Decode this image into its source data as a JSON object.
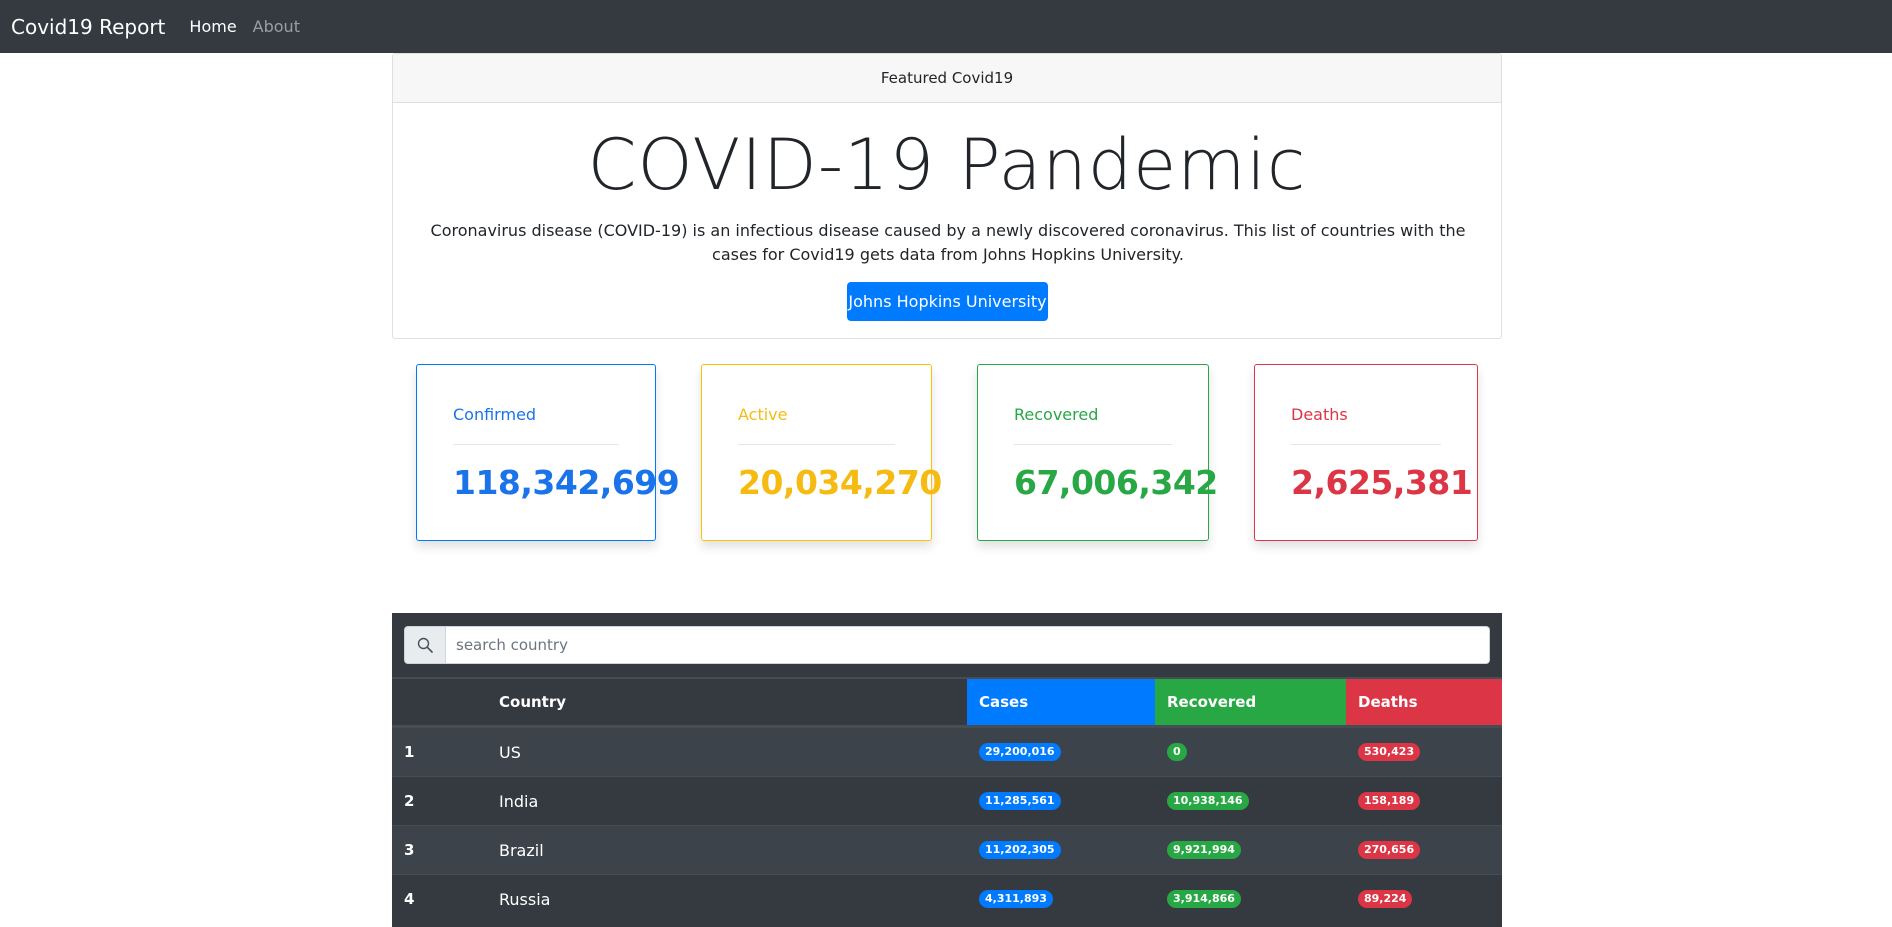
{
  "navbar": {
    "brand": "Covid19 Report",
    "links": [
      "Home",
      "About"
    ]
  },
  "featured": {
    "header": "Featured Covid19",
    "title": "COVID-19 Pandemic",
    "description": "Coronavirus disease (COVID-19) is an infectious disease caused by a newly discovered coronavirus. This list of countries with the cases for Covid19 gets data from Johns Hopkins University.",
    "button_label": "Johns Hopkins University"
  },
  "stats": {
    "confirmed": {
      "label": "Confirmed",
      "value": "118,342,699"
    },
    "active": {
      "label": "Active",
      "value": "20,034,270"
    },
    "recovered": {
      "label": "Recovered",
      "value": "67,006,342"
    },
    "deaths": {
      "label": "Deaths",
      "value": "2,625,381"
    }
  },
  "search": {
    "placeholder": "search country",
    "icon": "search-icon"
  },
  "table": {
    "headers": {
      "rank": "",
      "country": "Country",
      "cases": "Cases",
      "recovered": "Recovered",
      "deaths": "Deaths"
    },
    "rows": [
      {
        "rank": "1",
        "country": "US",
        "cases": "29,200,016",
        "recovered": "0",
        "deaths": "530,423"
      },
      {
        "rank": "2",
        "country": "India",
        "cases": "11,285,561",
        "recovered": "10,938,146",
        "deaths": "158,189"
      },
      {
        "rank": "3",
        "country": "Brazil",
        "cases": "11,202,305",
        "recovered": "9,921,994",
        "deaths": "270,656"
      },
      {
        "rank": "4",
        "country": "Russia",
        "cases": "4,311,893",
        "recovered": "3,914,866",
        "deaths": "89,224"
      }
    ]
  },
  "colors": {
    "navbar": "#343a40",
    "primary": "#007bff",
    "warning": "#ffc107",
    "success": "#28a745",
    "danger": "#dc3545"
  }
}
